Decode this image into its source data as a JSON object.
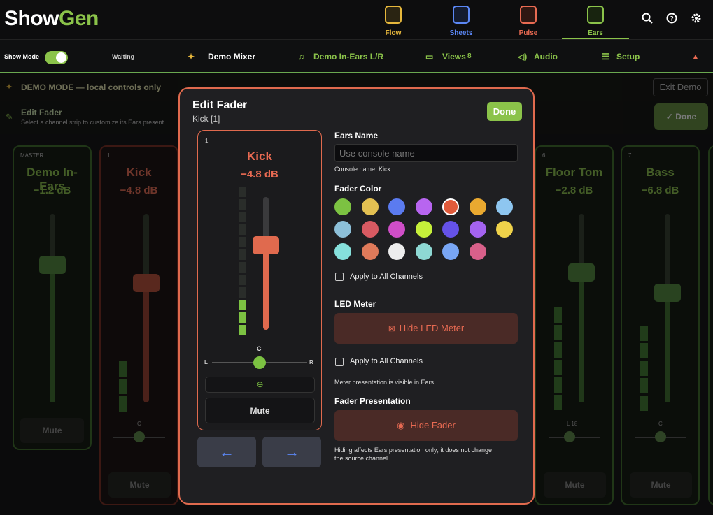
{
  "app": {
    "logo_a": "Show",
    "logo_b": "Gen"
  },
  "nav": {
    "tabs": [
      {
        "label": "Flow",
        "color": "#e6b73c"
      },
      {
        "label": "Sheets",
        "color": "#5b87f5"
      },
      {
        "label": "Pulse",
        "color": "#e86a52"
      },
      {
        "label": "Ears",
        "color": "#8bc34a",
        "active": true
      }
    ]
  },
  "bar": {
    "show_mode": "Show Mode",
    "waiting": "Waiting",
    "mixer": "Demo Mixer",
    "in_ears": "Demo In-Ears L/R",
    "views": "Views",
    "views_count": "8",
    "audio": "Audio",
    "setup": "Setup"
  },
  "demo": {
    "text": "DEMO MODE — local controls only",
    "exit": "Exit Demo"
  },
  "edit": {
    "title": "Edit Fader",
    "subtitle": "Select a channel strip to customize its Ears present",
    "done": "Done"
  },
  "strips": [
    {
      "num": "MASTER",
      "name": "Demo In-Ears",
      "db": "−1.2 dB",
      "mute": "Mute"
    },
    {
      "num": "1",
      "name": "Kick",
      "db": "−4.8 dB",
      "mute": "Mute",
      "pan": "C"
    },
    {
      "num": "6",
      "name": "Floor Tom",
      "db": "−2.8 dB",
      "mute": "Mute",
      "pan": "L 18"
    },
    {
      "num": "7",
      "name": "Bass",
      "db": "−6.8 dB",
      "mute": "Mute",
      "pan": "C"
    }
  ],
  "modal": {
    "title": "Edit Fader",
    "subtitle": "Kick [1]",
    "done": "Done",
    "preview": {
      "num": "1",
      "name": "Kick",
      "db": "−4.8 dB",
      "pan": "C",
      "L": "L",
      "R": "R",
      "mute": "Mute"
    },
    "ears_name_label": "Ears Name",
    "ears_name_placeholder": "Use console name",
    "console_name": "Console name: Kick",
    "fader_color_label": "Fader Color",
    "colors": [
      "#7cc242",
      "#e3c052",
      "#5b7bf0",
      "#b865f0",
      "#e05a3a",
      "#eaa930",
      "#8ec6f0",
      "#8cbfd8",
      "#d85a62",
      "#d04ec8",
      "#c6ef3a",
      "#6552e8",
      "#a463f0",
      "#efd24a",
      "#86e0dc",
      "#e07a5a",
      "#ededed",
      "#8ed8d4",
      "#79a6f5",
      "#d8608a"
    ],
    "apply_all_1": "Apply to All Channels",
    "led_meter_label": "LED Meter",
    "hide_led": "Hide LED Meter",
    "apply_all_2": "Apply to All Channels",
    "meter_note": "Meter presentation is visible in Ears.",
    "fader_presentation_label": "Fader Presentation",
    "hide_fader": "Hide Fader",
    "hide_note_1": "Hiding affects Ears presentation only; it does not change",
    "hide_note_2": "the source channel."
  }
}
